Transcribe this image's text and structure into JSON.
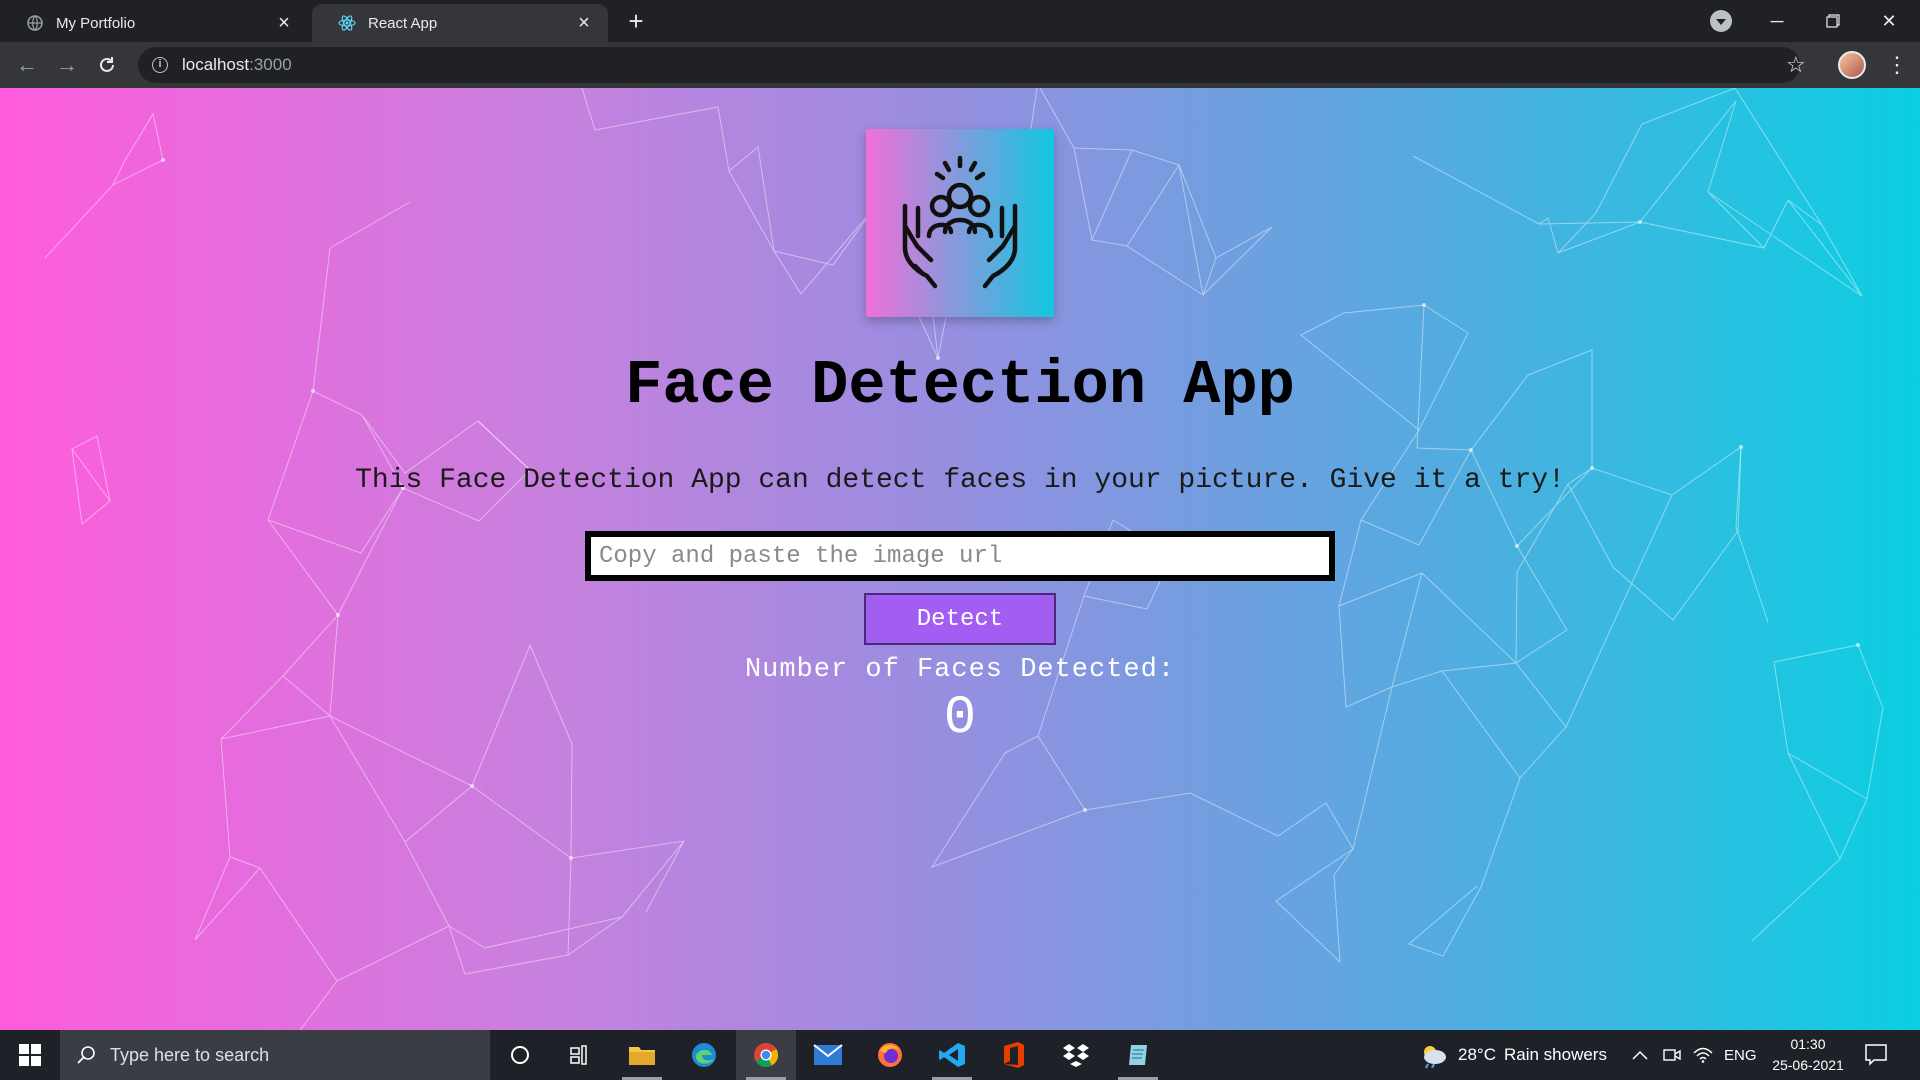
{
  "browser": {
    "tabs": [
      {
        "title": "My Portfolio",
        "active": false,
        "icon": "globe-icon"
      },
      {
        "title": "React App",
        "active": true,
        "icon": "react-icon"
      }
    ],
    "url_host": "localhost",
    "url_port": ":3000"
  },
  "page": {
    "title": "Face Detection App",
    "subtitle": "This Face Detection App can detect faces in your picture. Give it a try!",
    "input_placeholder": "Copy and paste the image url",
    "detect_label": "Detect",
    "faces_label": "Number of Faces Detected:",
    "faces_count": "0",
    "gradient_colors": [
      "#ff5bdc",
      "#9a8de0",
      "#0bcfe1"
    ]
  },
  "taskbar": {
    "search_placeholder": "Type here to search",
    "apps": [
      "cortana-icon",
      "task-view-icon",
      "file-explorer-icon",
      "edge-icon",
      "chrome-icon",
      "mail-icon",
      "firefox-icon",
      "vscode-icon",
      "office-icon",
      "dropbox-icon",
      "notepad-icon"
    ],
    "weather_temp": "28°C",
    "weather_condition": "Rain showers",
    "language": "ENG",
    "time": "01:30",
    "date": "25-06-2021"
  }
}
